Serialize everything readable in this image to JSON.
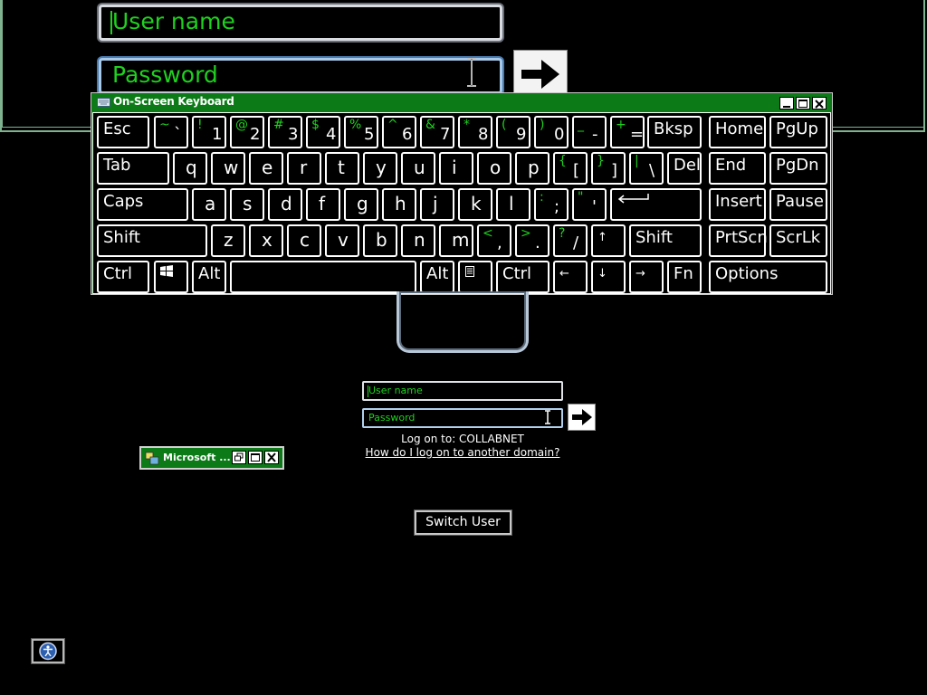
{
  "magnifier": {
    "username_placeholder": "User name",
    "password_placeholder": "Password"
  },
  "osk": {
    "title": "On-Screen Keyboard",
    "keys": {
      "esc": "Esc",
      "bksp": "Bksp",
      "home": "Home",
      "pgup": "PgUp",
      "tab": "Tab",
      "del": "Del",
      "end": "End",
      "pgdn": "PgDn",
      "caps": "Caps",
      "insert": "Insert",
      "pause": "Pause",
      "shift_left": "Shift",
      "shift_right": "Shift",
      "prtscn": "PrtScn",
      "scrlk": "ScrLk",
      "ctrl_left": "Ctrl",
      "alt_left": "Alt",
      "alt_right": "Alt",
      "ctrl_right": "Ctrl",
      "fn": "Fn",
      "options": "Options"
    },
    "number_row": [
      {
        "shift": "~",
        "low": "`"
      },
      {
        "shift": "!",
        "low": "1"
      },
      {
        "shift": "@",
        "low": "2"
      },
      {
        "shift": "#",
        "low": "3"
      },
      {
        "shift": "$",
        "low": "4"
      },
      {
        "shift": "%",
        "low": "5"
      },
      {
        "shift": "^",
        "low": "6"
      },
      {
        "shift": "&",
        "low": "7"
      },
      {
        "shift": "*",
        "low": "8"
      },
      {
        "shift": "(",
        "low": "9"
      },
      {
        "shift": ")",
        "low": "0"
      },
      {
        "shift": "_",
        "low": "-"
      },
      {
        "shift": "+",
        "low": "="
      }
    ],
    "row_q": [
      "q",
      "w",
      "e",
      "r",
      "t",
      "y",
      "u",
      "i",
      "o",
      "p"
    ],
    "row_q_syms": [
      {
        "shift": "{",
        "low": "["
      },
      {
        "shift": "}",
        "low": "]"
      },
      {
        "shift": "|",
        "low": "\\"
      }
    ],
    "row_a": [
      "a",
      "s",
      "d",
      "f",
      "g",
      "h",
      "j",
      "k",
      "l"
    ],
    "row_a_syms": [
      {
        "shift": ":",
        "low": ";"
      },
      {
        "shift": "\"",
        "low": "'"
      }
    ],
    "row_z": [
      "z",
      "x",
      "c",
      "v",
      "b",
      "n",
      "m"
    ],
    "row_z_syms": [
      {
        "shift": "<",
        "low": ","
      },
      {
        "shift": ">",
        "low": "."
      },
      {
        "shift": "?",
        "low": "/"
      }
    ],
    "arrows": {
      "up": "↑",
      "left": "←",
      "down": "↓",
      "right": "→"
    }
  },
  "logon": {
    "username_placeholder": "User name",
    "password_placeholder": "Password",
    "logon_to": "Log on to: COLLABNET",
    "other_domain_link": "How do I log on to another domain?",
    "switch_user": "Switch User"
  },
  "minimized_window": {
    "title": "Microsoft ..."
  },
  "colors": {
    "accent_green": "#1fd11f",
    "titlebar_green": "#0b7a17",
    "background": "#000000"
  }
}
